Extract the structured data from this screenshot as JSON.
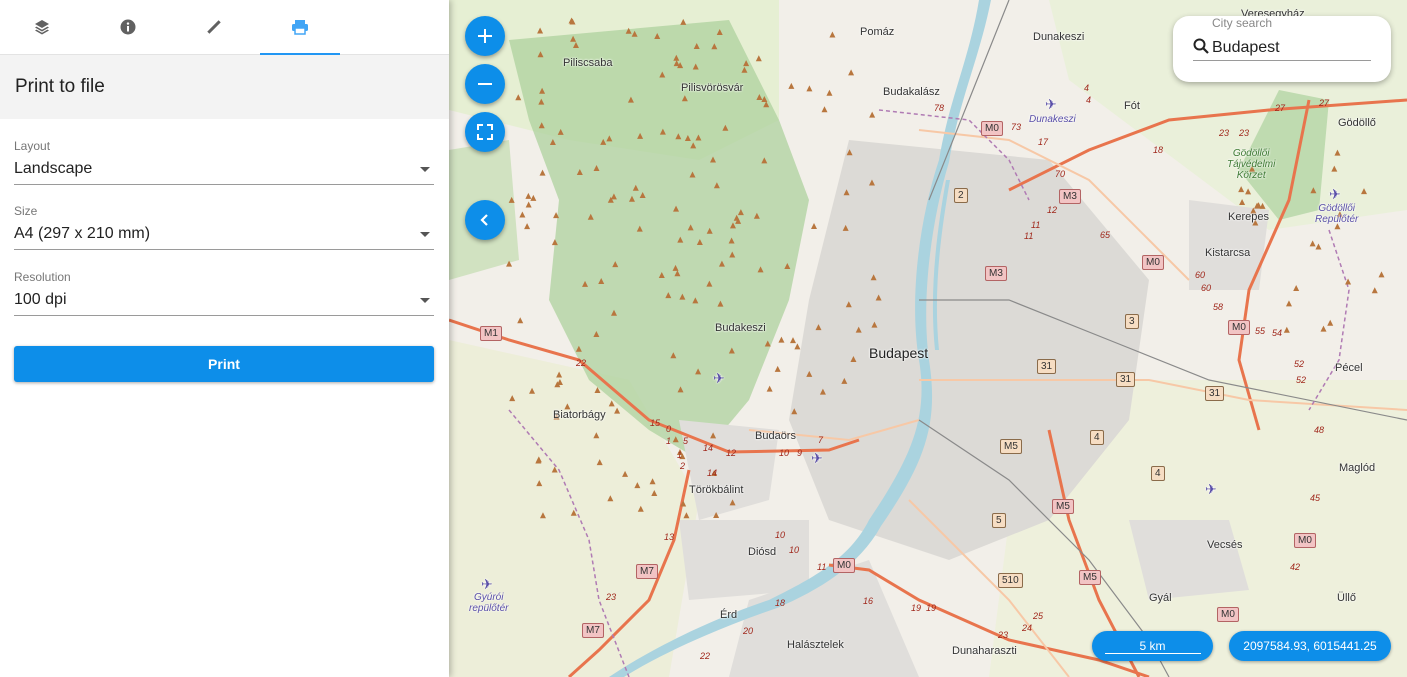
{
  "sidebar": {
    "tabs": [
      {
        "icon": "layers-icon"
      },
      {
        "icon": "info-icon"
      },
      {
        "icon": "ruler-icon"
      },
      {
        "icon": "printer-icon",
        "active": true
      }
    ],
    "panel_title": "Print to file",
    "layout": {
      "label": "Layout",
      "value": "Landscape"
    },
    "size": {
      "label": "Size",
      "value": "A4 (297 x 210 mm)"
    },
    "resolution": {
      "label": "Resolution",
      "value": "100 dpi"
    },
    "print_button": "Print"
  },
  "map": {
    "controls": {
      "zoom_in": "zoom-in-icon",
      "zoom_out": "zoom-out-icon",
      "fullscreen": "fullscreen-icon",
      "collapse": "chevron-left-icon"
    },
    "search": {
      "label": "City search",
      "value": "Budapest"
    },
    "scale": "5 km",
    "coordinates": "2097584.93, 6015441.25",
    "colors": {
      "accent": "#0d8ee9",
      "motorway": "#e8744d",
      "water": "#aad3df",
      "forest": "#add19e"
    },
    "places": {
      "budapest": "Budapest",
      "pomaz": "Pomáz",
      "piliscsaba": "Piliscsaba",
      "pilisvorosvar": "Pilisvörösvár",
      "budakalasz": "Budakalász",
      "dunakeszi": "Dunakeszi",
      "dunakeszi_airfield": "Dunakeszi",
      "fot": "Fót",
      "godollo": "Gödöllő",
      "veresegyhaz": "Veresegyház",
      "kerepes": "Kerepes",
      "kistarcsa": "Kistarcsa",
      "budakeszi": "Budakeszi",
      "biatorbagy": "Biatorbágy",
      "budaors": "Budaörs",
      "torokbalint": "Törökbálint",
      "diosd": "Diósd",
      "erd": "Érd",
      "halasztelek": "Halásztelek",
      "dunaharaszti": "Dunaharaszti",
      "gyal": "Gyál",
      "vecses": "Vecsés",
      "ullo": "Üllő",
      "pecel": "Pécel",
      "maglod": "Maglód",
      "gyori_repuloter": "Gyúrói\nrepülőtér",
      "godolloi_repuloter": "Gödöllői\nRepülőtér",
      "godolloi_tajvedelmi": "Gödöllői\nTájvédelmi\nKörzet"
    },
    "shields": [
      {
        "t": "M0",
        "m": true
      },
      {
        "t": "M3",
        "m": true
      },
      {
        "t": "M3",
        "m": true
      },
      {
        "t": "M0",
        "m": true
      },
      {
        "t": "M0",
        "m": true
      },
      {
        "t": "M1",
        "m": true
      },
      {
        "t": "M5",
        "m": true
      },
      {
        "t": "M5",
        "m": true
      },
      {
        "t": "M5",
        "m": true
      },
      {
        "t": "M7",
        "m": true
      },
      {
        "t": "M7",
        "m": true
      },
      {
        "t": "M0",
        "m": true
      },
      {
        "t": "M0",
        "m": true
      },
      {
        "t": "M0",
        "m": true
      },
      {
        "t": "2"
      },
      {
        "t": "3"
      },
      {
        "t": "31"
      },
      {
        "t": "31"
      },
      {
        "t": "31"
      },
      {
        "t": "4"
      },
      {
        "t": "4"
      },
      {
        "t": "5"
      },
      {
        "t": "510"
      }
    ],
    "route_numbers": [
      "78",
      "73",
      "17",
      "4",
      "4",
      "70",
      "12",
      "11",
      "11",
      "65",
      "18",
      "23",
      "23",
      "27",
      "27",
      "60",
      "60",
      "58",
      "55",
      "54",
      "52",
      "52",
      "48",
      "45",
      "42",
      "22",
      "15",
      "0",
      "1",
      "5",
      "14",
      "14",
      "12",
      "10",
      "9",
      "7",
      "2",
      "1",
      "13",
      "23",
      "22",
      "20",
      "18",
      "11",
      "10",
      "10",
      "16",
      "19",
      "19",
      "25",
      "24",
      "23"
    ]
  }
}
